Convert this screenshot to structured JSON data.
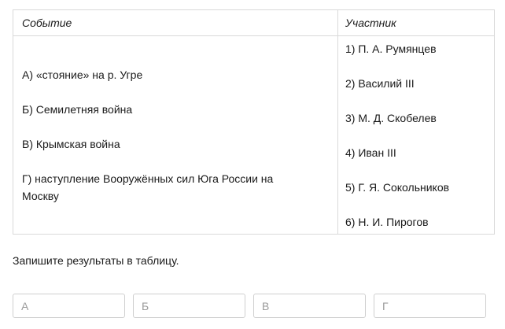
{
  "table": {
    "header_event": "Событие",
    "header_participant": "Участник",
    "events": [
      "А) «стояние» на р. Угре",
      "Б) Семилетняя война",
      "В) Крымская война",
      "Г) наступление Вооружённых сил Юга России на Москву"
    ],
    "participants": [
      "1) П. А. Румянцев",
      "2) Василий III",
      "3) М. Д. Скобелев",
      "4) Иван III",
      "5) Г. Я. Сокольников",
      "6) Н. И. Пирогов"
    ]
  },
  "instruction": "Запишите результаты в таблицу.",
  "answers": {
    "placeholders": [
      "А",
      "Б",
      "В",
      "Г"
    ],
    "values": [
      "",
      "",
      "",
      ""
    ]
  }
}
